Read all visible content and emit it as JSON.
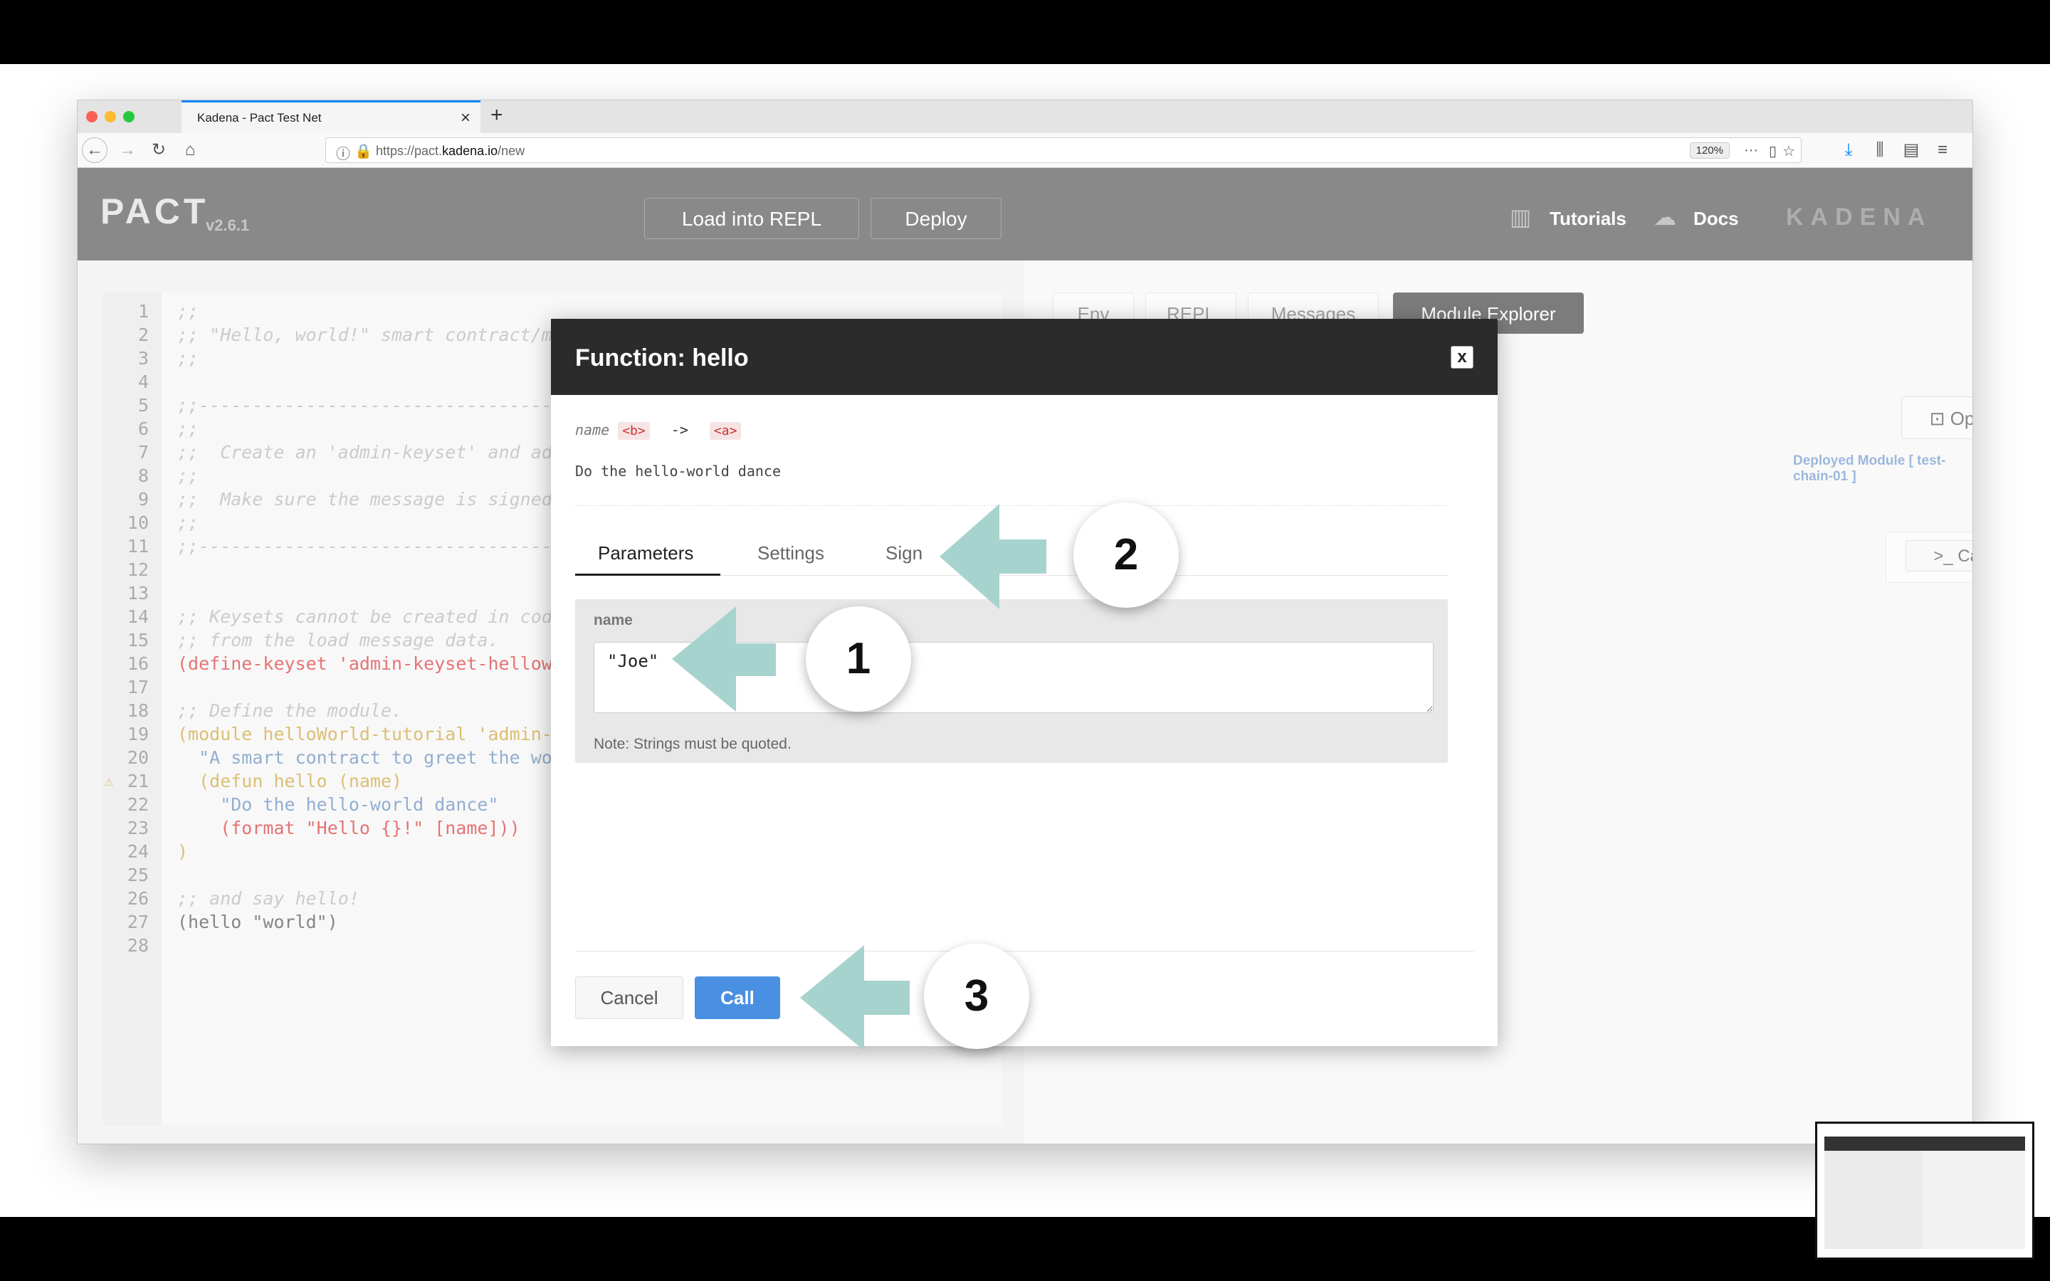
{
  "browser": {
    "tab_title": "Kadena - Pact Test Net",
    "url_prefix": "https://pact.",
    "url_domain": "kadena.io",
    "url_path": "/new",
    "zoom": "120%"
  },
  "header": {
    "logo": "PACT",
    "version": "v2.6.1",
    "load_button": "Load into REPL",
    "deploy_button": "Deploy",
    "tutorials": "Tutorials",
    "docs": "Docs",
    "brand": "KADENA"
  },
  "editor": {
    "lines": [
      {
        "n": "1",
        "text": ";;",
        "cls": "cm"
      },
      {
        "n": "2",
        "text": ";; \"Hello, world!\" smart contract/m",
        "cls": "cm"
      },
      {
        "n": "3",
        "text": ";;",
        "cls": "cm"
      },
      {
        "n": "4",
        "text": "",
        "cls": "cm"
      },
      {
        "n": "5",
        "text": ";;-------------------------------------",
        "cls": "cm"
      },
      {
        "n": "6",
        "text": ";;",
        "cls": "cm"
      },
      {
        "n": "7",
        "text": ";;  Create an 'admin-keyset' and ad",
        "cls": "cm"
      },
      {
        "n": "8",
        "text": ";;",
        "cls": "cm"
      },
      {
        "n": "9",
        "text": ";;  Make sure the message is signed",
        "cls": "cm"
      },
      {
        "n": "10",
        "text": ";;",
        "cls": "cm"
      },
      {
        "n": "11",
        "text": ";;-------------------------------------",
        "cls": "cm"
      },
      {
        "n": "12",
        "text": "",
        "cls": "cm"
      },
      {
        "n": "13",
        "text": "",
        "cls": "cm"
      },
      {
        "n": "14",
        "text": ";; Keysets cannot be created in cod",
        "cls": "cm"
      },
      {
        "n": "15",
        "text": ";; from the load message data.",
        "cls": "cm"
      },
      {
        "n": "16",
        "text": "(define-keyset 'admin-keyset-hellow",
        "cls": "rd"
      },
      {
        "n": "17",
        "text": "",
        "cls": "cm"
      },
      {
        "n": "18",
        "text": ";; Define the module.",
        "cls": "cm"
      },
      {
        "n": "19",
        "text": "(module helloWorld-tutorial 'admin-k",
        "cls": "kw"
      },
      {
        "n": "20",
        "text": "  \"A smart contract to greet the wo",
        "cls": "st"
      },
      {
        "n": "21",
        "text": "  (defun hello (name)",
        "cls": "kw"
      },
      {
        "n": "22",
        "text": "    \"Do the hello-world dance\"",
        "cls": "st"
      },
      {
        "n": "23",
        "text": "    (format \"Hello {}!\" [name]))",
        "cls": "rd"
      },
      {
        "n": "24",
        "text": ")",
        "cls": "kw"
      },
      {
        "n": "25",
        "text": "",
        "cls": "cm"
      },
      {
        "n": "26",
        "text": ";; and say hello!",
        "cls": "cm"
      },
      {
        "n": "27",
        "text": "(hello \"world\")",
        "cls": "tx"
      },
      {
        "n": "28",
        "text": "",
        "cls": "cm"
      }
    ],
    "warning_line": "21"
  },
  "right_panel": {
    "tabs": [
      "Env",
      "REPL",
      "Messages",
      "Module Explorer"
    ],
    "open_button": "Open",
    "deployed_label": "Deployed Module [ test-chain-01 ]",
    "call_button": "Call"
  },
  "modal": {
    "title_prefix": "Function: ",
    "title_name": "hello",
    "close": "x",
    "sig_param": "name",
    "sig_param_type": "<b>",
    "sig_arrow": "->",
    "sig_return_type": "<a>",
    "doc": "Do the hello-world dance",
    "tabs": [
      "Parameters",
      "Settings",
      "Sign"
    ],
    "active_tab": "Parameters",
    "param_label": "name",
    "param_value": "\"Joe\"",
    "param_note": "Note: Strings must be quoted.",
    "cancel_button": "Cancel",
    "call_button": "Call"
  },
  "annotations": [
    "1",
    "2",
    "3"
  ],
  "colors": {
    "header_bg": "#282828",
    "accent_blue": "#4a90e2",
    "annotation_arrow": "#a7d3ce"
  }
}
